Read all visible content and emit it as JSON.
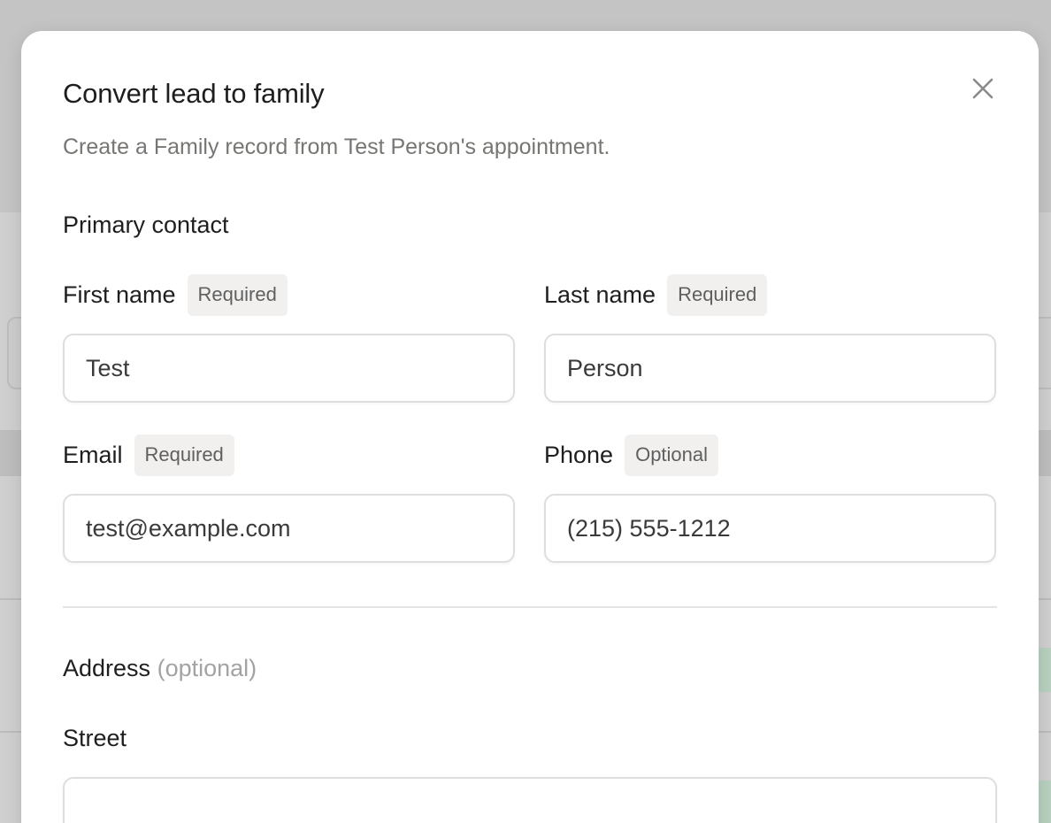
{
  "modal": {
    "title": "Convert lead to family",
    "subtitle": "Create a Family record from Test Person's appointment.",
    "close_icon": "close-icon"
  },
  "primary_contact": {
    "heading": "Primary contact",
    "first_name": {
      "label": "First name",
      "badge": "Required",
      "value": "Test"
    },
    "last_name": {
      "label": "Last name",
      "badge": "Required",
      "value": "Person"
    },
    "email": {
      "label": "Email",
      "badge": "Required",
      "value": "test@example.com"
    },
    "phone": {
      "label": "Phone",
      "badge": "Optional",
      "value": "(215) 555-1212"
    }
  },
  "address": {
    "heading": "Address",
    "heading_note": "(optional)",
    "street": {
      "label": "Street",
      "value": ""
    }
  },
  "colors": {
    "overlay": "#c9c9c9",
    "modal_bg": "#ffffff",
    "text_primary": "#1e1e1e",
    "text_muted": "#777672",
    "badge_bg": "#f1f0ef",
    "input_border": "#dedede"
  }
}
